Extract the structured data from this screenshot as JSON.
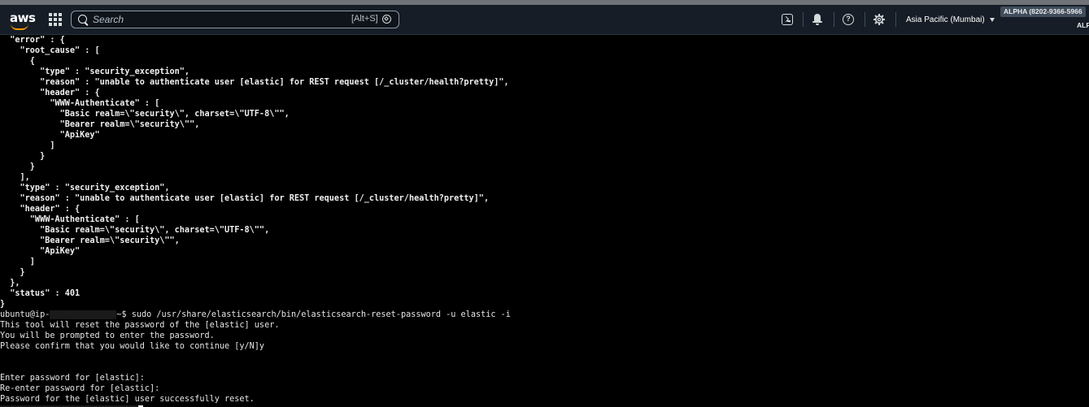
{
  "navbar": {
    "logo_text": "aws",
    "search_placeholder": "Search",
    "search_shortcut": "[Alt+S]",
    "region_label": "Asia Pacific (Mumbai)",
    "account_badge": "ALPHA (8202-9366-5966",
    "account_short": "ALF",
    "icons": [
      "services-grid-icon",
      "search-icon",
      "cloudshell-icon",
      "bell-icon",
      "help-icon",
      "gear-icon",
      "caret-down-icon"
    ]
  },
  "terminal": {
    "lines": [
      "  \"error\" : {",
      "    \"root_cause\" : [",
      "      {",
      "        \"type\" : \"security_exception\",",
      "        \"reason\" : \"unable to authenticate user [elastic] for REST request [/_cluster/health?pretty]\",",
      "        \"header\" : {",
      "          \"WWW-Authenticate\" : [",
      "            \"Basic realm=\\\"security\\\", charset=\\\"UTF-8\\\"\",",
      "            \"Bearer realm=\\\"security\\\"\",",
      "            \"ApiKey\"",
      "          ]",
      "        }",
      "      }",
      "    ],",
      "    \"type\" : \"security_exception\",",
      "    \"reason\" : \"unable to authenticate user [elastic] for REST request [/_cluster/health?pretty]\",",
      "    \"header\" : {",
      "      \"WWW-Authenticate\" : [",
      "        \"Basic realm=\\\"security\\\", charset=\\\"UTF-8\\\"\",",
      "        \"Bearer realm=\\\"security\\\"\",",
      "        \"ApiKey\"",
      "      ]",
      "    }",
      "  },",
      "  \"status\" : 401",
      "}"
    ],
    "prompt_prefix": "ubuntu@ip-",
    "prompt_suffix": "~$ sudo /usr/share/elasticsearch/bin/elasticsearch-reset-password -u elastic -i",
    "output_lines": [
      "This tool will reset the password of the [elastic] user.",
      "You will be prompted to enter the password.",
      "Please confirm that you would like to continue [y/N]y",
      "",
      "",
      "Enter password for [elastic]:",
      "Re-enter password for [elastic]:",
      "Password for the [elastic] user successfully reset."
    ]
  }
}
